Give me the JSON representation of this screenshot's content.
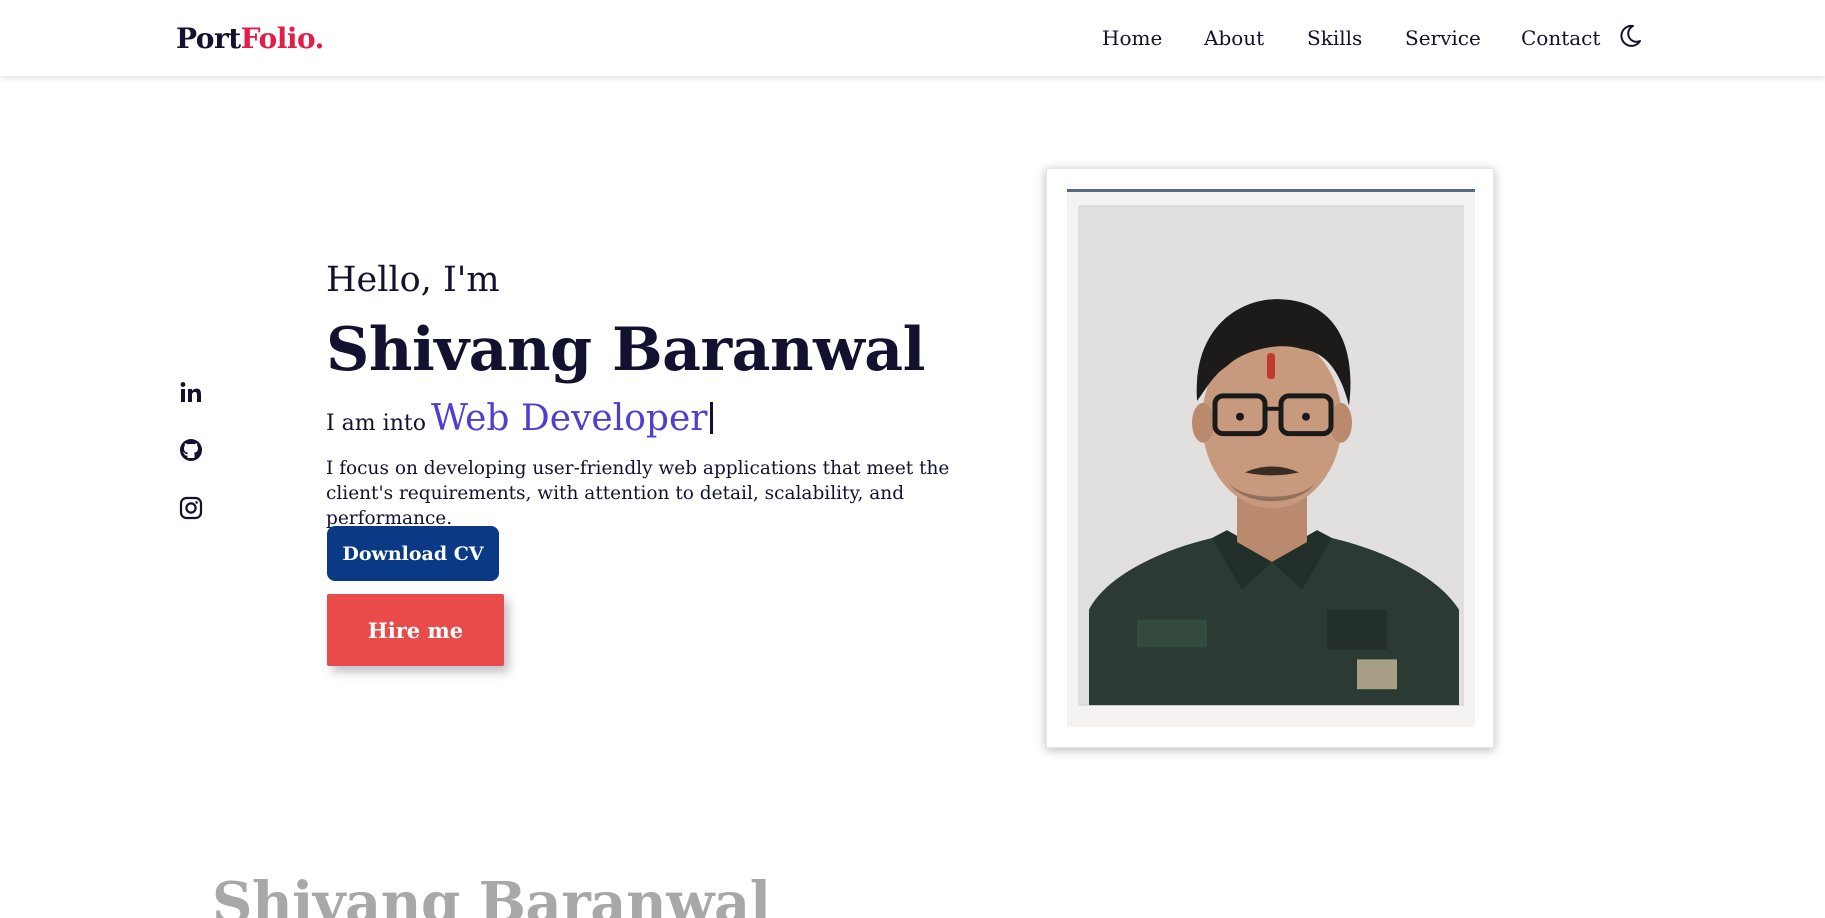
{
  "nav": {
    "logo_part1": "Port",
    "logo_part2": "Folio.",
    "links": [
      {
        "label": "Home"
      },
      {
        "label": "About"
      },
      {
        "label": "Skills"
      },
      {
        "label": "Service"
      },
      {
        "label": "Contact"
      }
    ],
    "theme_toggle_icon": "moon-icon"
  },
  "social": [
    {
      "icon": "linkedin-icon"
    },
    {
      "icon": "github-icon"
    },
    {
      "icon": "instagram-icon"
    }
  ],
  "hero": {
    "greeting": "Hello, I'm",
    "name": "Shivang Baranwal",
    "role_prefix": "I am into",
    "role_value": "Web Developer",
    "bio": "I focus on developing user-friendly web applications that meet the client's requirements, with attention to detail, scalability, and performance.",
    "download_cv_label": "Download CV",
    "hire_me_label": "Hire me"
  },
  "section_next": {
    "title": "Shivang Baranwal"
  },
  "colors": {
    "brand_dark": "#121230",
    "brand_accent": "#e11d48",
    "role_accent": "#4f3fd1",
    "cv_button": "#0a3a86",
    "hire_button": "#e94b4b"
  }
}
